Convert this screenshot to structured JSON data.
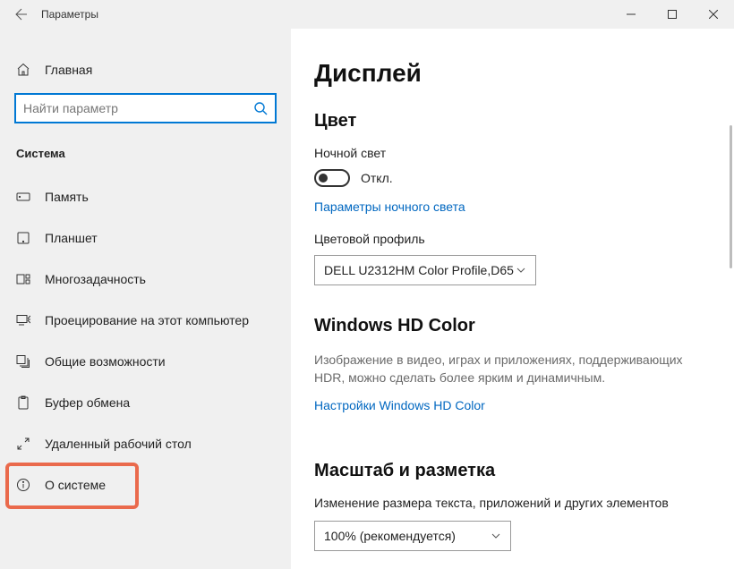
{
  "titlebar": {
    "app_name": "Параметры"
  },
  "sidebar": {
    "home": "Главная",
    "search_placeholder": "Найти параметр",
    "category": "Система",
    "items": [
      {
        "label": "Память"
      },
      {
        "label": "Планшет"
      },
      {
        "label": "Многозадачность"
      },
      {
        "label": "Проецирование на этот компьютер"
      },
      {
        "label": "Общие возможности"
      },
      {
        "label": "Буфер обмена"
      },
      {
        "label": "Удаленный рабочий стол"
      },
      {
        "label": "О системе"
      }
    ]
  },
  "main": {
    "title": "Дисплей",
    "color": {
      "heading": "Цвет",
      "night_label": "Ночной свет",
      "toggle_state": "Откл.",
      "night_link": "Параметры ночного света",
      "profile_label": "Цветовой профиль",
      "profile_value": "DELL U2312HM Color Profile,D65"
    },
    "hd": {
      "heading": "Windows HD Color",
      "desc": "Изображение в видео, играх и приложениях, поддерживающих HDR, можно сделать более ярким и динамичным.",
      "link": "Настройки Windows HD Color"
    },
    "scale": {
      "heading": "Масштаб и разметка",
      "field_label": "Изменение размера текста, приложений и других элементов",
      "value": "100% (рекомендуется)"
    }
  }
}
